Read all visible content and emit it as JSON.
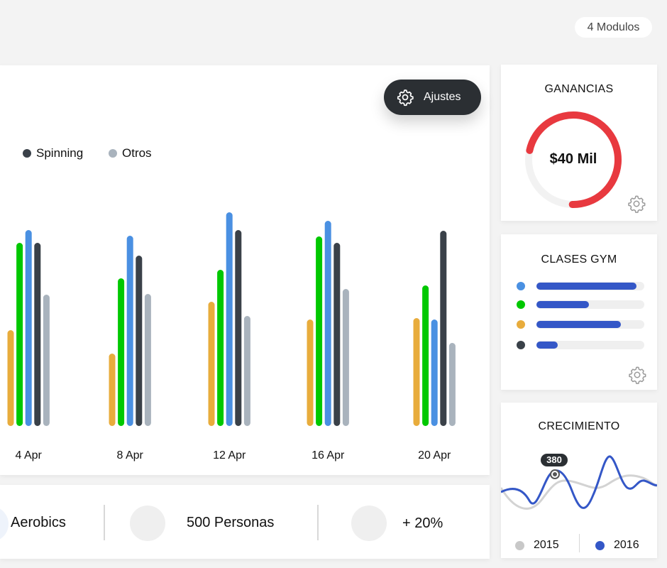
{
  "header": {
    "modules_label": "4 Modulos"
  },
  "main_chart": {
    "settings_label": "Ajustes",
    "legend": [
      {
        "name": "Spinning",
        "color": "#3a4149"
      },
      {
        "name": "Otros",
        "color": "#a9b3bd"
      }
    ]
  },
  "chart_data": {
    "type": "bar",
    "categories": [
      "4 Apr",
      "8 Apr",
      "12 Apr",
      "16 Apr",
      "20 Apr"
    ],
    "series": [
      {
        "color": "#e8ac3c",
        "values": [
          135,
          102,
          175,
          150,
          152
        ]
      },
      {
        "color": "#00c800",
        "values": [
          258,
          208,
          220,
          267,
          198
        ]
      },
      {
        "color": "#4a90e2",
        "values": [
          276,
          268,
          301,
          289,
          150
        ]
      },
      {
        "name": "Spinning",
        "color": "#3a4149",
        "values": [
          258,
          240,
          276,
          258,
          275
        ]
      },
      {
        "name": "Otros",
        "color": "#a9b3bd",
        "values": [
          185,
          186,
          155,
          193,
          117
        ]
      }
    ],
    "ylim": [
      0,
      320
    ]
  },
  "stats": [
    {
      "label": "Aerobics"
    },
    {
      "label": "500 Personas"
    },
    {
      "label": "+ 20%"
    }
  ],
  "ganancias": {
    "title": "GANANCIAS",
    "value_label": "$40 Mil",
    "progress": 0.72,
    "ring_color": "#e8393f"
  },
  "clases_gym": {
    "title": "CLASES GYM",
    "items": [
      {
        "dot_color": "#4a90e2",
        "fill": 0.93
      },
      {
        "dot_color": "#00c800",
        "fill": 0.49
      },
      {
        "dot_color": "#e8ac3c",
        "fill": 0.78
      },
      {
        "dot_color": "#3a4149",
        "fill": 0.2
      }
    ]
  },
  "crecimiento": {
    "title": "CRECIMIENTO",
    "tooltip": "380",
    "legend": [
      {
        "year": "2015",
        "color": "#c8c8c8"
      },
      {
        "year": "2016",
        "color": "#3457c7"
      }
    ]
  }
}
